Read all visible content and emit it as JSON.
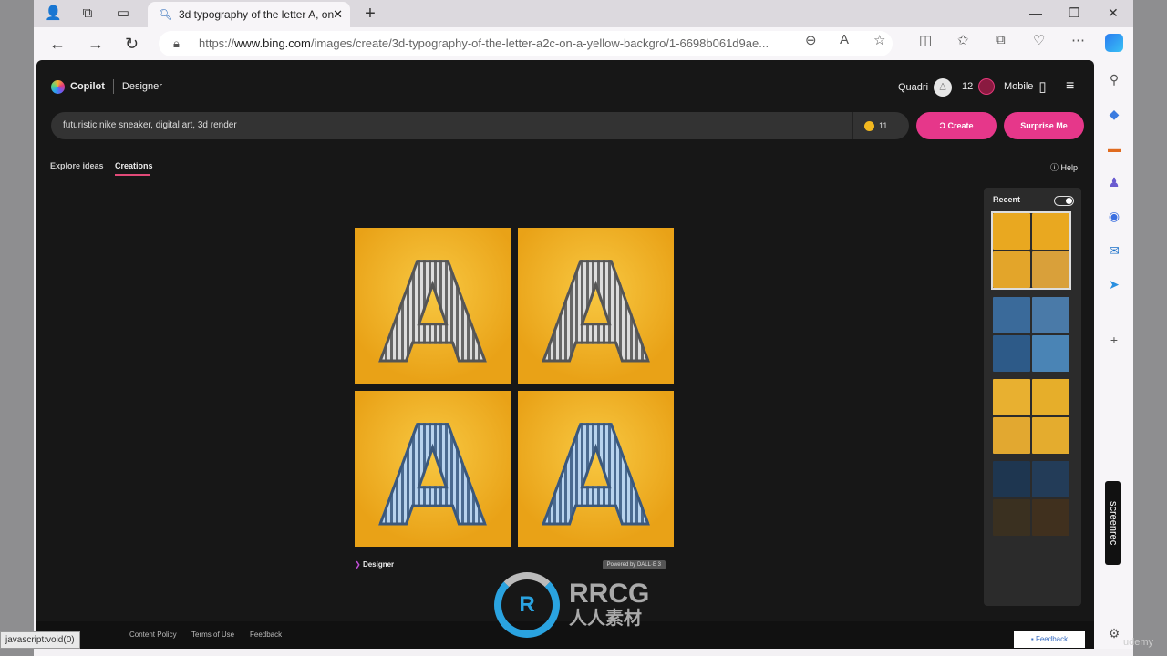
{
  "browser": {
    "tab_title": "3d typography of the letter A, on",
    "url_prefix": "https://",
    "url_domain": "www.bing.com",
    "url_rest": "/images/create/3d-typography-of-the-letter-a2c-on-a-yellow-backgro/1-6698b061d9ae..."
  },
  "app": {
    "brand": "Copilot",
    "product": "Designer",
    "user": "Quadri",
    "rewards": "12",
    "mobile": "Mobile"
  },
  "search": {
    "value": "futuristic nike sneaker, digital art, 3d render",
    "boosts": "11"
  },
  "buttons": {
    "create": "Create",
    "surprise": "Surprise Me"
  },
  "tabs": {
    "explore": "Explore ideas",
    "creations": "Creations",
    "help": "Help"
  },
  "result": {
    "designer": "Designer",
    "powered": "Powered by DALL·E 3",
    "letter": "A"
  },
  "recent": {
    "title": "Recent"
  },
  "footer": {
    "status": "javascript:void(0)",
    "content_policy": "Content Policy",
    "terms": "Terms of Use",
    "feedback": "Feedback",
    "feedback_button": "Feedback"
  },
  "overlay": {
    "screenrec": "screenrec",
    "wm_main": "RRCG",
    "wm_sub": "人人素材",
    "udemy": "udemy"
  },
  "colors": {
    "accent": "#e6378a",
    "bg": "#171717"
  }
}
